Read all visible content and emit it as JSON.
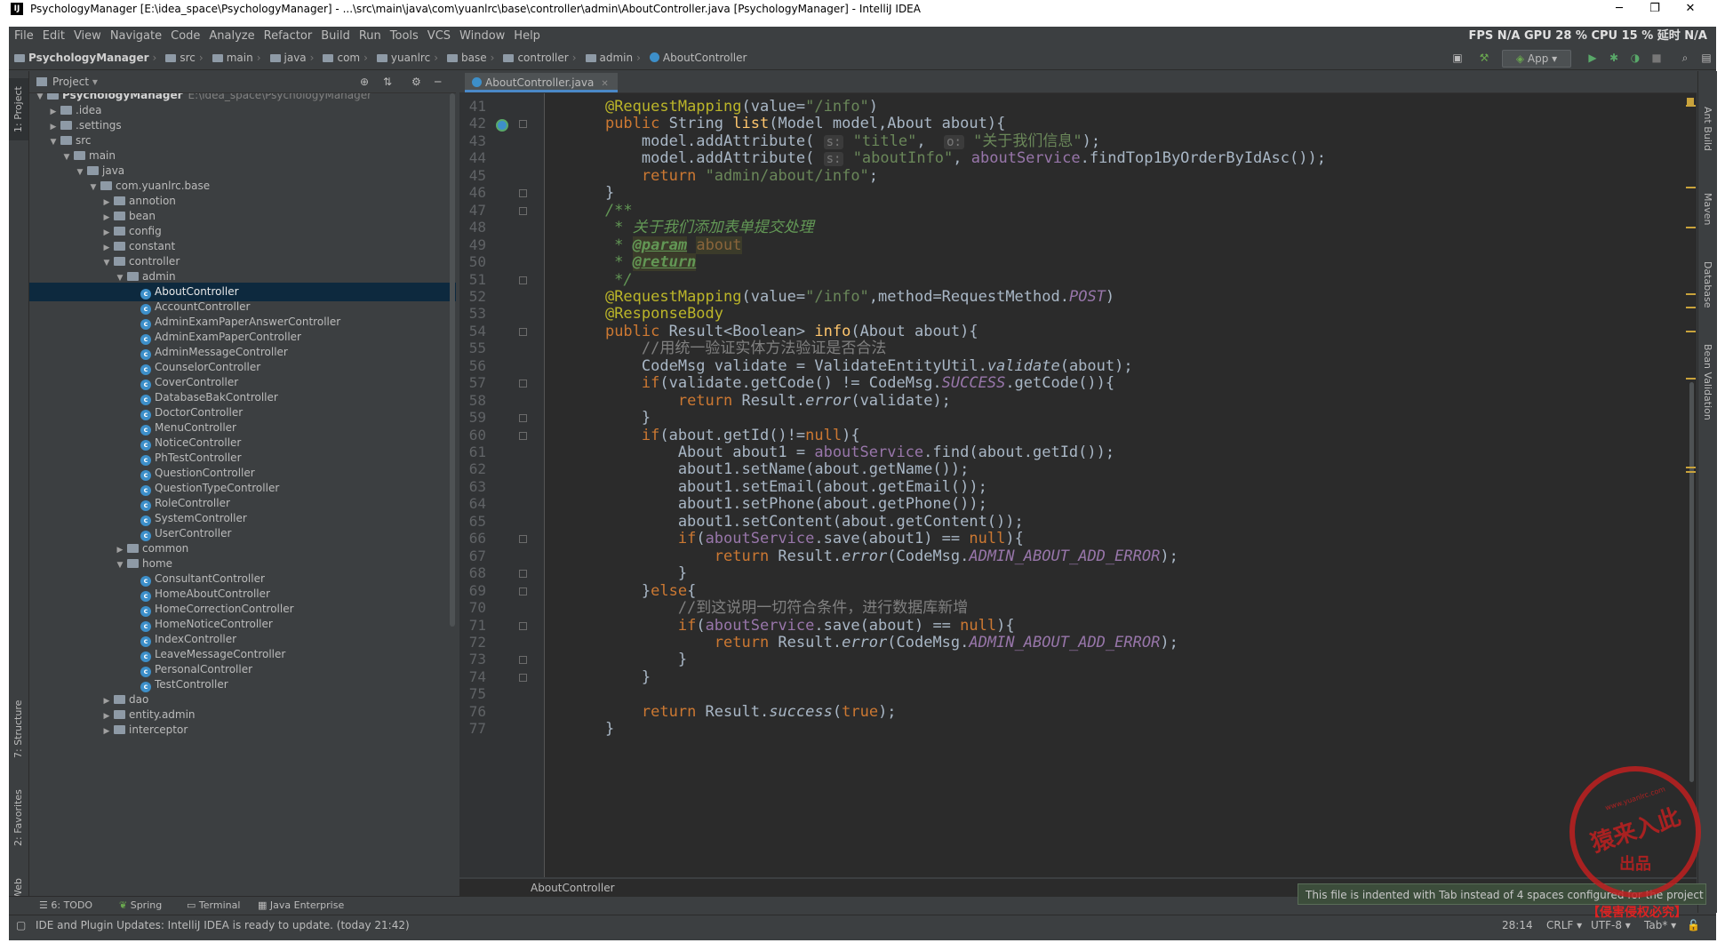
{
  "window": {
    "title": "PsychologyManager [E:\\idea_space\\PsychologyManager] - ...\\src\\main\\java\\com\\yuanlrc\\base\\controller\\admin\\AboutController.java [PsychologyManager] - IntelliJ IDEA",
    "app_icon": "IJ"
  },
  "menu": [
    "File",
    "Edit",
    "View",
    "Navigate",
    "Code",
    "Analyze",
    "Refactor",
    "Build",
    "Run",
    "Tools",
    "VCS",
    "Window",
    "Help"
  ],
  "perf": "FPS N/A GPU 28 % CPU 15 % 延时 N/A",
  "breadcrumbs": [
    "PsychologyManager",
    "src",
    "main",
    "java",
    "com",
    "yuanlrc",
    "base",
    "controller",
    "admin",
    "AboutController"
  ],
  "toolbar": {
    "run_config": "App"
  },
  "project_panel": {
    "title": "Project",
    "tree": [
      {
        "label": "PsychologyManager",
        "path": "E:\\idea_space\\PsychologyManager",
        "type": "root",
        "arrow": "▼"
      },
      {
        "label": ".idea",
        "type": "folder",
        "arrow": "▶"
      },
      {
        "label": ".settings",
        "type": "folder",
        "arrow": "▶"
      },
      {
        "label": "src",
        "type": "folder",
        "arrow": "▼"
      },
      {
        "label": "main",
        "type": "folder",
        "arrow": "▼"
      },
      {
        "label": "java",
        "type": "folder",
        "arrow": "▼"
      },
      {
        "label": "com.yuanlrc.base",
        "type": "folder",
        "arrow": "▼"
      },
      {
        "label": "annotion",
        "type": "folder",
        "arrow": "▶"
      },
      {
        "label": "bean",
        "type": "folder",
        "arrow": "▶"
      },
      {
        "label": "config",
        "type": "folder",
        "arrow": "▶"
      },
      {
        "label": "constant",
        "type": "folder",
        "arrow": "▶"
      },
      {
        "label": "controller",
        "type": "folder",
        "arrow": "▼"
      },
      {
        "label": "admin",
        "type": "folder",
        "arrow": "▼"
      },
      {
        "label": "AboutController",
        "type": "class",
        "selected": true
      },
      {
        "label": "AccountController",
        "type": "class"
      },
      {
        "label": "AdminExamPaperAnswerController",
        "type": "class"
      },
      {
        "label": "AdminExamPaperController",
        "type": "class"
      },
      {
        "label": "AdminMessageController",
        "type": "class"
      },
      {
        "label": "CounselorController",
        "type": "class"
      },
      {
        "label": "CoverController",
        "type": "class"
      },
      {
        "label": "DatabaseBakController",
        "type": "class"
      },
      {
        "label": "DoctorController",
        "type": "class"
      },
      {
        "label": "MenuController",
        "type": "class"
      },
      {
        "label": "NoticeController",
        "type": "class"
      },
      {
        "label": "PhTestController",
        "type": "class"
      },
      {
        "label": "QuestionController",
        "type": "class"
      },
      {
        "label": "QuestionTypeController",
        "type": "class"
      },
      {
        "label": "RoleController",
        "type": "class"
      },
      {
        "label": "SystemController",
        "type": "class"
      },
      {
        "label": "UserController",
        "type": "class"
      },
      {
        "label": "common",
        "type": "folder",
        "arrow": "▶"
      },
      {
        "label": "home",
        "type": "folder",
        "arrow": "▼"
      },
      {
        "label": "ConsultantController",
        "type": "class"
      },
      {
        "label": "HomeAboutController",
        "type": "class"
      },
      {
        "label": "HomeCorrectionController",
        "type": "class"
      },
      {
        "label": "HomeNoticeController",
        "type": "class"
      },
      {
        "label": "IndexController",
        "type": "class"
      },
      {
        "label": "LeaveMessageController",
        "type": "class"
      },
      {
        "label": "PersonalController",
        "type": "class"
      },
      {
        "label": "TestController",
        "type": "class"
      },
      {
        "label": "dao",
        "type": "folder",
        "arrow": "▶"
      },
      {
        "label": "entity.admin",
        "type": "folder",
        "arrow": "▶"
      },
      {
        "label": "interceptor",
        "type": "folder",
        "arrow": "▶"
      }
    ]
  },
  "editor": {
    "tab": "AboutController.java",
    "breadcrumb": "AboutController",
    "line_numbers": [
      41,
      42,
      43,
      44,
      45,
      46,
      47,
      48,
      49,
      50,
      51,
      52,
      53,
      54,
      55,
      56,
      57,
      58,
      59,
      60,
      61,
      62,
      63,
      64,
      65,
      66,
      67,
      68,
      69,
      70,
      71,
      72,
      73,
      74,
      75,
      76,
      77
    ],
    "code_lines": [
      "    @RequestMapping(value=\"/info\")",
      "    public String list(Model model,About about){",
      "        model.addAttribute( s: \"title\",  o: \"关于我们信息\");",
      "        model.addAttribute( s: \"aboutInfo\", aboutService.findTop1ByOrderByIdAsc());",
      "        return \"admin/about/info\";",
      "    }",
      "    /**",
      "     * 关于我们添加表单提交处理",
      "     * @param about",
      "     * @return",
      "     */",
      "    @RequestMapping(value=\"/info\",method=RequestMethod.POST)",
      "    @ResponseBody",
      "    public Result<Boolean> info(About about){",
      "        //用统一验证实体方法验证是否合法",
      "        CodeMsg validate = ValidateEntityUtil.validate(about);",
      "        if(validate.getCode() != CodeMsg.SUCCESS.getCode()){",
      "            return Result.error(validate);",
      "        }",
      "        if(about.getId()!=null){",
      "            About about1 = aboutService.find(about.getId());",
      "            about1.setName(about.getName());",
      "            about1.setEmail(about.getEmail());",
      "            about1.setPhone(about.getPhone());",
      "            about1.setContent(about.getContent());",
      "            if(aboutService.save(about1) == null){",
      "                return Result.error(CodeMsg.ADMIN_ABOUT_ADD_ERROR);",
      "            }",
      "        }else{",
      "            //到这说明一切符合条件，进行数据库新增",
      "            if(aboutService.save(about) == null){",
      "                return Result.error(CodeMsg.ADMIN_ABOUT_ADD_ERROR);",
      "            }",
      "        }",
      "",
      "        return Result.success(true);",
      "    }"
    ]
  },
  "left_tool_tabs": [
    "1: Project",
    "7: Structure",
    "2: Favorites",
    "Web"
  ],
  "right_tool_tabs": [
    "Ant Build",
    "Maven",
    "Database",
    "Bean Validation"
  ],
  "bottom_tabs": [
    "6: TODO",
    "Spring",
    "Terminal",
    "Java Enterprise"
  ],
  "notification": "This file is indented with Tab instead of 4 spaces configured for the project",
  "status": {
    "message": "IDE and Plugin Updates: IntelliJ IDEA is ready to update. (today 21:42)",
    "position": "28:14",
    "line_sep": "CRLF",
    "encoding": "UTF-8",
    "indent": "Tab*"
  },
  "watermark": {
    "main": "猿来入此",
    "sub": "出品",
    "url": "www.yuanlrc.com",
    "footer": "【侵害侵权必究】"
  }
}
